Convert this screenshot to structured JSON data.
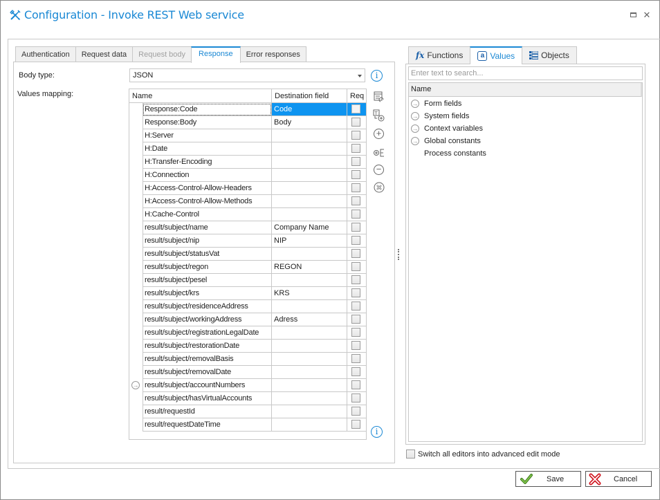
{
  "window": {
    "title": "Configuration - Invoke REST Web service",
    "title_icon": "tools-icon",
    "controls": {
      "maximize": "maximize-icon",
      "close": "✕"
    }
  },
  "left_tabs": [
    {
      "label": "Authentication",
      "state": "normal"
    },
    {
      "label": "Request data",
      "state": "normal"
    },
    {
      "label": "Request body",
      "state": "disabled"
    },
    {
      "label": "Response",
      "state": "active"
    },
    {
      "label": "Error responses",
      "state": "normal"
    }
  ],
  "response": {
    "body_type_label": "Body type:",
    "body_type_value": "JSON",
    "values_mapping_label": "Values mapping:",
    "grid": {
      "columns": [
        "Name",
        "Destination field",
        "Req"
      ],
      "rows": [
        {
          "name": "Response:Code",
          "destination": "Code",
          "req": false
        },
        {
          "name": "Response:Body",
          "destination": "Body",
          "req": false
        },
        {
          "name": "H:Server",
          "destination": "",
          "req": false
        },
        {
          "name": "H:Date",
          "destination": "",
          "req": false
        },
        {
          "name": "H:Transfer-Encoding",
          "destination": "",
          "req": false
        },
        {
          "name": "H:Connection",
          "destination": "",
          "req": false
        },
        {
          "name": "H:Access-Control-Allow-Headers",
          "destination": "",
          "req": false
        },
        {
          "name": "H:Access-Control-Allow-Methods",
          "destination": "",
          "req": false
        },
        {
          "name": "H:Cache-Control",
          "destination": "",
          "req": false
        },
        {
          "name": "result/subject/name",
          "destination": "Company Name",
          "req": false
        },
        {
          "name": "result/subject/nip",
          "destination": "NIP",
          "req": false
        },
        {
          "name": "result/subject/statusVat",
          "destination": "",
          "req": false
        },
        {
          "name": "result/subject/regon",
          "destination": "REGON",
          "req": false
        },
        {
          "name": "result/subject/pesel",
          "destination": "",
          "req": false
        },
        {
          "name": "result/subject/krs",
          "destination": "KRS",
          "req": false
        },
        {
          "name": "result/subject/residenceAddress",
          "destination": "",
          "req": false
        },
        {
          "name": "result/subject/workingAddress",
          "destination": "Adress",
          "req": false
        },
        {
          "name": "result/subject/registrationLegalDate",
          "destination": "",
          "req": false
        },
        {
          "name": "result/subject/restorationDate",
          "destination": "",
          "req": false
        },
        {
          "name": "result/subject/removalBasis",
          "destination": "",
          "req": false
        },
        {
          "name": "result/subject/removalDate",
          "destination": "",
          "req": false
        },
        {
          "name": "result/subject/accountNumbers",
          "destination": "",
          "req": false,
          "expandable": true
        },
        {
          "name": "result/subject/hasVirtualAccounts",
          "destination": "",
          "req": false
        },
        {
          "name": "result/requestId",
          "destination": "",
          "req": false
        },
        {
          "name": "result/requestDateTime",
          "destination": "",
          "req": false
        }
      ],
      "selected_row": 0
    },
    "tools": [
      "refresh-grid-icon",
      "add-template-icon",
      "add-row-icon",
      "add-child-icon",
      "remove-row-icon",
      "clear-all-icon"
    ]
  },
  "right_tabs": [
    {
      "label": "Functions",
      "icon": "fx",
      "state": "normal"
    },
    {
      "label": "Values",
      "icon": "a",
      "state": "active"
    },
    {
      "label": "Objects",
      "icon": "objects",
      "state": "normal"
    }
  ],
  "values_panel": {
    "search_placeholder": "Enter text to search...",
    "column": "Name",
    "items": [
      {
        "label": "Form fields",
        "expandable": true
      },
      {
        "label": "System fields",
        "expandable": true
      },
      {
        "label": "Context variables",
        "expandable": true
      },
      {
        "label": "Global constants",
        "expandable": true
      },
      {
        "label": "Process constants",
        "expandable": false
      }
    ]
  },
  "advanced_mode": {
    "label": "Switch all editors into advanced edit mode",
    "checked": false
  },
  "buttons": {
    "save": "Save",
    "cancel": "Cancel"
  },
  "colors": {
    "accent": "#1a88d4",
    "selection": "#0e94f0",
    "save_icon": "#5aa02c",
    "cancel_icon": "#d0141e"
  }
}
